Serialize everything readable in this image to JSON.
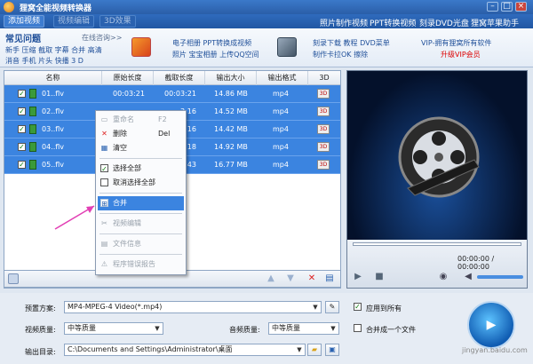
{
  "app": {
    "title": "狸窝全能视频转换器"
  },
  "toolbar": {
    "add_video": "添加视频",
    "video_edit": "视频编辑",
    "effects": "3D效果",
    "links": [
      "照片制作视频",
      "PPT转换视频",
      "刻录DVD光盘",
      "狸窝苹果助手"
    ]
  },
  "banner": {
    "faq_title": "常见问题",
    "online_help": "在线咨询>>",
    "faq_line1": "新手 压缩 截取 字幕 合并 高清",
    "faq_line2": "消音 手机 片头 快播 3 D",
    "ad1_line1": "电子相册 PPT转换成视频",
    "ad1_line2": "照片 宝宝相册 上传QQ空间",
    "ad2_line1": "刻录下载 教程 DVD菜单",
    "ad2_line2": "制作卡拉OK 擦除",
    "vip_line1": "VIP-拥有狸窝所有软件",
    "vip_line2": "升级VIP会员"
  },
  "list": {
    "headers": [
      "名称",
      "原始长度",
      "截取长度",
      "输出大小",
      "输出格式",
      "3D"
    ],
    "rows": [
      {
        "name": "01..flv",
        "orig": "00:03:21",
        "cut": "00:03:21",
        "size": "14.86 MB",
        "format": "mp4"
      },
      {
        "name": "02..flv",
        "orig": "",
        "cut": "3:16",
        "size": "14.52 MB",
        "format": "mp4"
      },
      {
        "name": "03..flv",
        "orig": "",
        "cut": "3:16",
        "size": "14.42 MB",
        "format": "mp4"
      },
      {
        "name": "04..flv",
        "orig": "",
        "cut": "3:18",
        "size": "14.92 MB",
        "format": "mp4"
      },
      {
        "name": "05..flv",
        "orig": "",
        "cut": "3:43",
        "size": "16.77 MB",
        "format": "mp4"
      }
    ]
  },
  "context_menu": {
    "items": [
      {
        "label": "重命名",
        "shortcut": "F2"
      },
      {
        "label": "删除",
        "shortcut": "Del"
      },
      {
        "label": "清空",
        "shortcut": ""
      },
      {
        "label": "选择全部",
        "shortcut": ""
      },
      {
        "label": "取消选择全部",
        "shortcut": ""
      },
      {
        "label": "合并",
        "shortcut": ""
      },
      {
        "label": "视频编辑",
        "shortcut": ""
      },
      {
        "label": "文件信息",
        "shortcut": ""
      },
      {
        "label": "程序错误报告",
        "shortcut": ""
      }
    ]
  },
  "preview": {
    "time": "00:00:00 / 00:00:00"
  },
  "bottom": {
    "preset_label": "预置方案:",
    "preset_value": "MP4-MPEG-4 Video(*.mp4)",
    "apply_all": "应用到所有",
    "vquality_label": "视频质量:",
    "vquality_value": "中等质量",
    "aquality_label": "音频质量:",
    "aquality_value": "中等质量",
    "merge_label": "合并成一个文件",
    "output_label": "输出目录:",
    "output_value": "C:\\Documents and Settings\\Administrator\\桌面"
  },
  "watermark": "jingyan.baidu.com",
  "colors": {
    "accent": "#3b84e0",
    "title_bar": "#2a5ea8",
    "highlight_arrow": "#e23fb4"
  }
}
